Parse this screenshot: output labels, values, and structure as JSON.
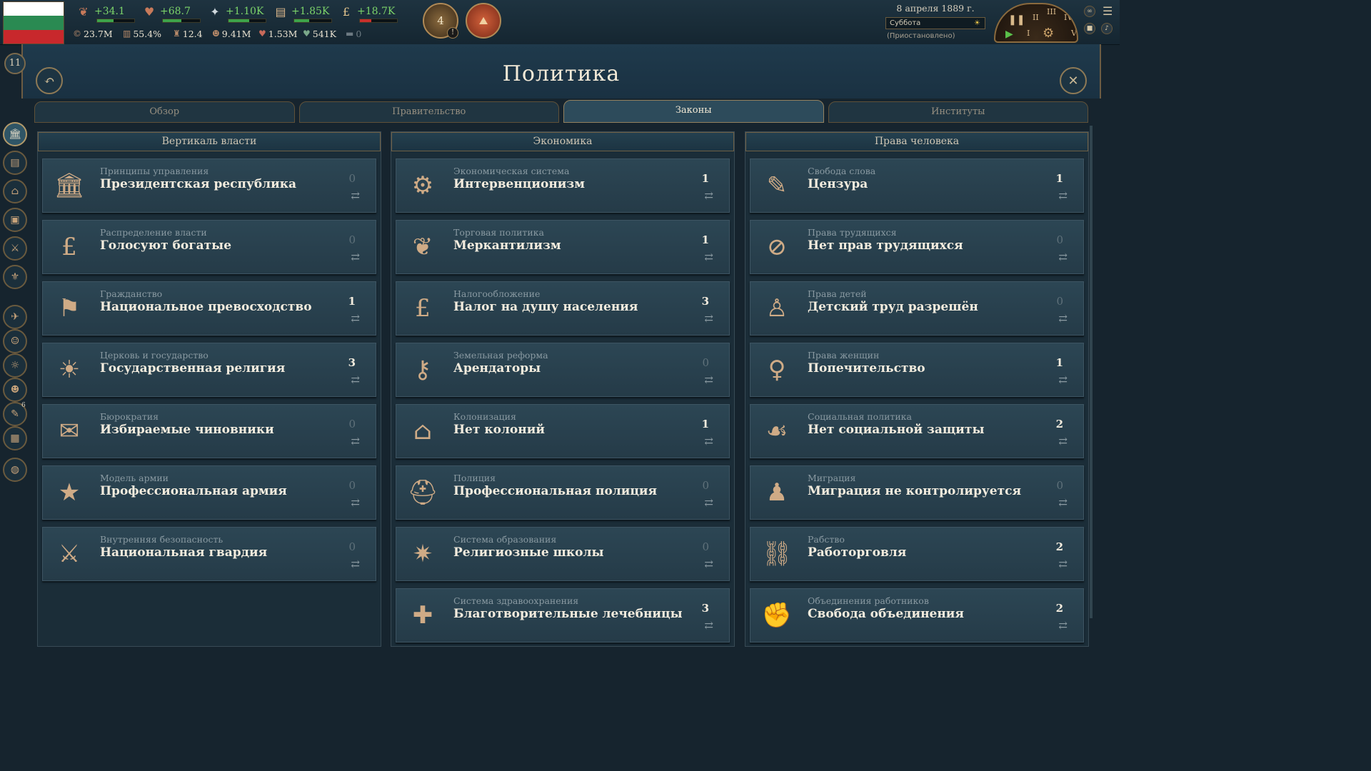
{
  "country_rank": "11",
  "flag_colors": [
    "#ffffff",
    "#2a8a52",
    "#c8282c"
  ],
  "resources": [
    {
      "icon": "authority-icon",
      "value": "+34.1",
      "bar_fill": 0.45,
      "bar_color": "#3ea34a"
    },
    {
      "icon": "influence-icon",
      "value": "+68.7",
      "bar_fill": 0.5,
      "bar_color": "#3ea34a"
    },
    {
      "icon": "bureaucracy-icon",
      "value": "+1.10K",
      "bar_fill": 0.55,
      "bar_color": "#3ea34a"
    },
    {
      "icon": "production-icon",
      "value": "+1.85K",
      "bar_fill": 0.4,
      "bar_color": "#3ea34a"
    },
    {
      "icon": "money-icon",
      "value": "+18.7K",
      "bar_fill": 0.3,
      "bar_color": "#c8302c"
    }
  ],
  "stats": [
    {
      "icon": "gdp-icon",
      "value": "23.7M"
    },
    {
      "icon": "literacy-icon",
      "value": "55.4%"
    },
    {
      "icon": "standard-of-living-icon",
      "value": "12.4"
    },
    {
      "icon": "population-icon",
      "value": "9.41M"
    },
    {
      "icon": "workforce-icon",
      "value": "1.53M"
    },
    {
      "icon": "incorporated-icon",
      "value": "541K"
    },
    {
      "icon": "army-icon",
      "value": "0"
    }
  ],
  "medals": [
    {
      "name": "journal-medal",
      "label": "4"
    },
    {
      "name": "map-medal",
      "label": ""
    }
  ],
  "date": "8 апреля 1889 г.",
  "day_of_week": "Суббота",
  "paused_label": "(Приостановлено)",
  "speed_wheel": [
    "II",
    "III",
    "IV",
    "V",
    "I"
  ],
  "title": "Политика",
  "tabs": [
    {
      "label": "Обзор",
      "active": false
    },
    {
      "label": "Правительство",
      "active": false
    },
    {
      "label": "Законы",
      "active": true
    },
    {
      "label": "Институты",
      "active": false
    }
  ],
  "sidenav": [
    {
      "icon": "politics-icon",
      "active": true
    },
    {
      "icon": "budget-icon",
      "active": false
    },
    {
      "icon": "buildings-icon",
      "active": false
    },
    {
      "icon": "market-icon",
      "active": false
    },
    {
      "icon": "military-icon",
      "active": false
    },
    {
      "icon": "diplomacy-icon",
      "active": false
    },
    {
      "icon": "dove-icon",
      "active": false
    },
    {
      "icon": "population-icon",
      "active": false
    },
    {
      "icon": "interest-groups-icon",
      "active": false
    },
    {
      "icon": "culture-icon",
      "active": false
    },
    {
      "icon": "journal-icon",
      "active": false,
      "badge": "6"
    },
    {
      "icon": "ledger-icon",
      "active": false
    },
    {
      "icon": "globe-icon",
      "active": false
    }
  ],
  "columns": [
    {
      "title": "Вертикаль власти",
      "laws": [
        {
          "category": "Принципы управления",
          "name": "Президентская республика",
          "count": "0",
          "icon": "columns-icon",
          "glyph": "🏛"
        },
        {
          "category": "Распределение власти",
          "name": "Голосуют богатые",
          "count": "0",
          "icon": "pound-icon",
          "glyph": "£"
        },
        {
          "category": "Гражданство",
          "name": "Национальное превосходство",
          "count": "1",
          "icon": "flag-hand-icon",
          "glyph": "⚑"
        },
        {
          "category": "Церковь и государство",
          "name": "Государственная религия",
          "count": "3",
          "icon": "sun-temple-icon",
          "glyph": "☀"
        },
        {
          "category": "Бюрократия",
          "name": "Избираемые чиновники",
          "count": "0",
          "icon": "stamp-icon",
          "glyph": "✉"
        },
        {
          "category": "Модель армии",
          "name": "Профессиональная армия",
          "count": "0",
          "icon": "star-medal-icon",
          "glyph": "★"
        },
        {
          "category": "Внутренняя безопасность",
          "name": "Национальная гвардия",
          "count": "0",
          "icon": "soldiers-icon",
          "glyph": "⚔"
        }
      ]
    },
    {
      "title": "Экономика",
      "laws": [
        {
          "category": "Экономическая система",
          "name": "Интервенционизм",
          "count": "1",
          "icon": "factory-icon",
          "glyph": "⚙"
        },
        {
          "category": "Торговая политика",
          "name": "Меркантилизм",
          "count": "1",
          "icon": "wheat-icon",
          "glyph": "❦"
        },
        {
          "category": "Налогообложение",
          "name": "Налог на душу населения",
          "count": "3",
          "icon": "money-bag-icon",
          "glyph": "£"
        },
        {
          "category": "Земельная реформа",
          "name": "Арендаторы",
          "count": "0",
          "icon": "key-hand-icon",
          "glyph": "⚷"
        },
        {
          "category": "Колонизация",
          "name": "Нет колоний",
          "count": "1",
          "icon": "no-house-icon",
          "glyph": "⌂"
        },
        {
          "category": "Полиция",
          "name": "Профессиональная полиция",
          "count": "0",
          "icon": "police-helmet-icon",
          "glyph": "⛑"
        },
        {
          "category": "Система образования",
          "name": "Религиозные школы",
          "count": "0",
          "icon": "book-icon",
          "glyph": "✷"
        },
        {
          "category": "Система здравоохранения",
          "name": "Благотворительные лечебницы",
          "count": "3",
          "icon": "medical-icon",
          "glyph": "✚"
        }
      ]
    },
    {
      "title": "Права человека",
      "laws": [
        {
          "category": "Свобода слова",
          "name": "Цензура",
          "count": "1",
          "icon": "speech-bubble-icon",
          "glyph": "✎"
        },
        {
          "category": "Права трудящихся",
          "name": "Нет прав трудящихся",
          "count": "0",
          "icon": "no-workers-icon",
          "glyph": "⊘"
        },
        {
          "category": "Права детей",
          "name": "Детский труд разрешён",
          "count": "0",
          "icon": "child-icon",
          "glyph": "♙"
        },
        {
          "category": "Права женщин",
          "name": "Попечительство",
          "count": "1",
          "icon": "no-female-icon",
          "glyph": "♀"
        },
        {
          "category": "Социальная политика",
          "name": "Нет социальной защиты",
          "count": "2",
          "icon": "praying-hands-icon",
          "glyph": "☙"
        },
        {
          "category": "Миграция",
          "name": "Миграция не контролируется",
          "count": "0",
          "icon": "migrant-icon",
          "glyph": "♟"
        },
        {
          "category": "Рабство",
          "name": "Работорговля",
          "count": "2",
          "icon": "shackles-icon",
          "glyph": "⛓"
        },
        {
          "category": "Объединения работников",
          "name": "Свобода объединения",
          "count": "2",
          "icon": "workers-union-icon",
          "glyph": "✊"
        }
      ]
    }
  ]
}
